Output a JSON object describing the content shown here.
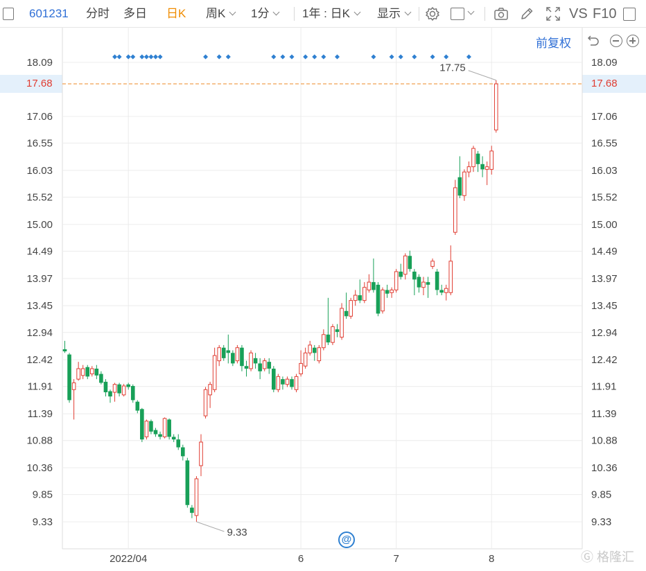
{
  "toolbar": {
    "stock_code": "601231",
    "tabs": [
      "分时",
      "多日",
      "日K",
      "周K",
      "1分"
    ],
    "active_tab": "日K",
    "range_label": "1年 : 日K",
    "display_label": "显示",
    "vs_label": "VS",
    "f10_label": "F10"
  },
  "subbar": {
    "fq_label": "前复权"
  },
  "colors": {
    "up": "#e03c31",
    "down": "#18a058",
    "accent": "#f08c00",
    "link": "#2f6fd6",
    "marker": "#2f80d1",
    "grid": "#ececec",
    "crosshair": "#f0a050"
  },
  "current_price_label": "17.68",
  "max_label": "17.75",
  "min_label": "9.33",
  "watermark": "格隆汇",
  "chart_data": {
    "type": "candlestick",
    "y_ticks": [
      "18.09",
      "17.68",
      "17.06",
      "16.55",
      "16.03",
      "15.52",
      "15.00",
      "14.49",
      "13.97",
      "13.45",
      "12.94",
      "12.42",
      "11.91",
      "11.39",
      "10.88",
      "10.36",
      "9.85",
      "9.33"
    ],
    "x_ticks": [
      {
        "label": "2022/04",
        "index": 14
      },
      {
        "label": "6",
        "index": 52
      },
      {
        "label": "7",
        "index": 73
      },
      {
        "label": "8",
        "index": 94
      }
    ],
    "current_price": 17.68,
    "max": 17.75,
    "min": 9.33,
    "marker_indices": [
      11,
      12,
      14,
      15,
      17,
      18,
      19,
      20,
      21,
      31,
      34,
      36,
      46,
      48,
      50,
      53,
      55,
      57,
      60,
      68,
      72,
      74,
      77,
      81,
      84,
      89
    ],
    "candles": [
      [
        12.62,
        12.58,
        12.78,
        12.55
      ],
      [
        12.52,
        11.65,
        12.55,
        11.6
      ],
      [
        11.85,
        11.98,
        12.05,
        11.28
      ],
      [
        12.05,
        12.25,
        12.38,
        12.02
      ],
      [
        12.12,
        12.25,
        12.32,
        12.05
      ],
      [
        12.28,
        12.1,
        12.32,
        12.05
      ],
      [
        12.15,
        12.25,
        12.3,
        12.1
      ],
      [
        12.25,
        12.12,
        12.32,
        12.05
      ],
      [
        12.15,
        11.98,
        12.2,
        11.95
      ],
      [
        12.0,
        11.8,
        12.05,
        11.72
      ],
      [
        11.82,
        11.72,
        11.85,
        11.6
      ],
      [
        11.8,
        11.95,
        11.98,
        11.62
      ],
      [
        11.95,
        11.78,
        11.98,
        11.72
      ],
      [
        11.75,
        11.92,
        11.96,
        11.72
      ],
      [
        11.95,
        11.9,
        11.98,
        11.85
      ],
      [
        11.92,
        11.65,
        11.95,
        11.6
      ],
      [
        11.62,
        11.45,
        11.65,
        11.4
      ],
      [
        11.48,
        10.9,
        11.5,
        10.85
      ],
      [
        10.95,
        11.25,
        11.28,
        10.9
      ],
      [
        11.25,
        11.05,
        11.28,
        11.0
      ],
      [
        11.08,
        11.0,
        11.12,
        10.95
      ],
      [
        11.0,
        10.95,
        11.05,
        10.9
      ],
      [
        10.95,
        11.3,
        11.32,
        10.92
      ],
      [
        11.28,
        10.95,
        11.3,
        10.9
      ],
      [
        10.95,
        10.9,
        11.0,
        10.85
      ],
      [
        10.9,
        10.75,
        11.0,
        10.7
      ],
      [
        10.75,
        10.58,
        10.8,
        10.5
      ],
      [
        10.5,
        9.65,
        10.55,
        9.6
      ],
      [
        9.6,
        9.5,
        9.65,
        9.4
      ],
      [
        9.45,
        10.15,
        10.2,
        9.33
      ],
      [
        10.4,
        10.85,
        11.0,
        10.2
      ],
      [
        11.35,
        11.85,
        11.9,
        11.3
      ],
      [
        11.75,
        11.95,
        12.0,
        11.5
      ],
      [
        11.85,
        12.5,
        12.65,
        11.8
      ],
      [
        12.4,
        12.65,
        12.7,
        12.3
      ],
      [
        12.65,
        12.45,
        12.7,
        12.4
      ],
      [
        12.6,
        12.55,
        12.9,
        12.35
      ],
      [
        12.55,
        12.35,
        12.6,
        12.3
      ],
      [
        12.4,
        12.65,
        12.7,
        12.35
      ],
      [
        12.65,
        12.3,
        12.7,
        12.2
      ],
      [
        12.3,
        12.25,
        12.4,
        12.1
      ],
      [
        12.25,
        12.55,
        12.6,
        12.2
      ],
      [
        12.45,
        12.35,
        12.55,
        12.25
      ],
      [
        12.35,
        12.2,
        12.45,
        12.05
      ],
      [
        12.25,
        12.4,
        12.45,
        12.2
      ],
      [
        12.38,
        12.25,
        12.45,
        12.15
      ],
      [
        12.25,
        11.85,
        12.3,
        11.8
      ],
      [
        11.85,
        12.1,
        12.15,
        11.8
      ],
      [
        12.05,
        11.95,
        12.1,
        11.85
      ],
      [
        11.95,
        12.05,
        12.1,
        11.9
      ],
      [
        12.05,
        11.9,
        12.1,
        11.85
      ],
      [
        11.85,
        12.1,
        12.15,
        11.8
      ],
      [
        12.15,
        12.35,
        12.6,
        12.1
      ],
      [
        12.3,
        12.55,
        12.65,
        12.25
      ],
      [
        12.55,
        12.7,
        12.78,
        12.5
      ],
      [
        12.65,
        12.55,
        12.7,
        12.4
      ],
      [
        12.4,
        12.65,
        12.7,
        12.35
      ],
      [
        12.65,
        12.9,
        13.0,
        12.6
      ],
      [
        12.9,
        12.75,
        13.6,
        12.7
      ],
      [
        12.75,
        13.05,
        13.1,
        12.7
      ],
      [
        13.0,
        12.95,
        13.1,
        12.85
      ],
      [
        12.85,
        13.4,
        13.5,
        12.8
      ],
      [
        13.35,
        13.25,
        13.7,
        13.2
      ],
      [
        13.25,
        13.55,
        13.6,
        13.2
      ],
      [
        13.55,
        13.65,
        13.75,
        13.45
      ],
      [
        13.65,
        13.55,
        13.95,
        13.5
      ],
      [
        13.55,
        13.8,
        13.9,
        13.5
      ],
      [
        13.75,
        13.9,
        14.05,
        13.7
      ],
      [
        13.9,
        13.75,
        14.35,
        13.7
      ],
      [
        13.85,
        13.3,
        13.9,
        13.25
      ],
      [
        13.35,
        13.75,
        13.8,
        13.3
      ],
      [
        13.75,
        13.68,
        13.85,
        13.6
      ],
      [
        13.7,
        13.75,
        13.8,
        13.6
      ],
      [
        13.75,
        14.1,
        14.15,
        13.7
      ],
      [
        14.1,
        14.0,
        14.25,
        13.95
      ],
      [
        14.05,
        14.4,
        14.45,
        13.95
      ],
      [
        14.4,
        14.15,
        14.5,
        14.1
      ],
      [
        14.1,
        13.95,
        14.15,
        13.65
      ],
      [
        14.0,
        13.8,
        14.05,
        13.7
      ],
      [
        13.8,
        13.9,
        14.0,
        13.65
      ],
      [
        13.9,
        13.85,
        14.0,
        13.6
      ],
      [
        14.2,
        14.3,
        14.35,
        14.15
      ],
      [
        14.1,
        13.75,
        14.15,
        13.65
      ],
      [
        13.75,
        13.7,
        13.85,
        13.65
      ],
      [
        13.7,
        13.78,
        13.85,
        13.55
      ],
      [
        13.7,
        14.3,
        14.6,
        13.65
      ],
      [
        14.85,
        15.7,
        15.85,
        14.8
      ],
      [
        15.9,
        15.55,
        16.3,
        15.5
      ],
      [
        15.55,
        16.0,
        16.05,
        15.45
      ],
      [
        16.0,
        16.1,
        16.2,
        15.9
      ],
      [
        16.1,
        16.45,
        16.5,
        16.0
      ],
      [
        16.35,
        16.15,
        16.4,
        16.0
      ],
      [
        16.15,
        16.05,
        16.3,
        15.9
      ],
      [
        16.05,
        16.1,
        16.2,
        15.75
      ],
      [
        16.05,
        16.4,
        16.5,
        15.95
      ],
      [
        16.8,
        17.68,
        17.75,
        16.75
      ]
    ]
  }
}
